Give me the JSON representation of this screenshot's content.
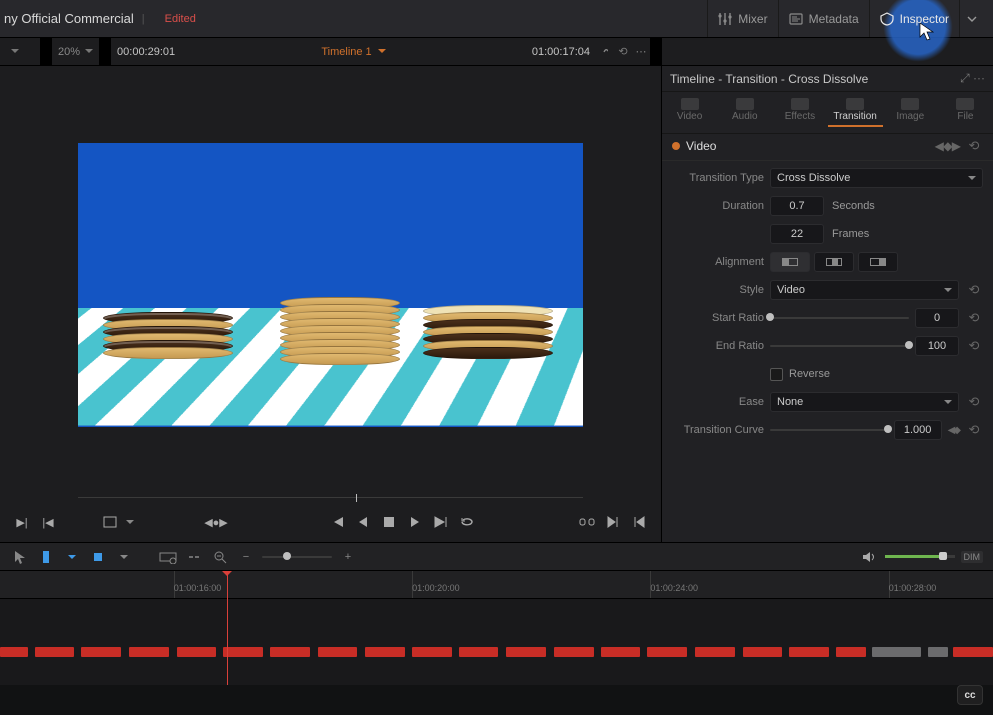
{
  "header": {
    "project_title": "ny Official Commercial",
    "project_state": "Edited",
    "buttons": {
      "mixer": "Mixer",
      "metadata": "Metadata",
      "inspector": "Inspector"
    }
  },
  "subbar": {
    "zoom": "20%",
    "left_tc": "00:00:29:01",
    "timeline_name": "Timeline 1",
    "main_tc": "01:00:17:04"
  },
  "inspector": {
    "crumb": "Timeline - Transition - Cross Dissolve",
    "tabs": {
      "video": "Video",
      "audio": "Audio",
      "effects": "Effects",
      "transition": "Transition",
      "image": "Image",
      "file": "File"
    },
    "section_title": "Video",
    "labels": {
      "transition_type": "Transition Type",
      "duration": "Duration",
      "alignment": "Alignment",
      "style": "Style",
      "start_ratio": "Start Ratio",
      "end_ratio": "End Ratio",
      "reverse": "Reverse",
      "ease": "Ease",
      "transition_curve": "Transition Curve"
    },
    "values": {
      "transition_type": "Cross Dissolve",
      "duration_sec": "0.7",
      "duration_sec_unit": "Seconds",
      "duration_frames": "22",
      "duration_frames_unit": "Frames",
      "style": "Video",
      "start_ratio": "0",
      "end_ratio": "100",
      "ease": "None",
      "transition_curve": "1.000"
    }
  },
  "timeline": {
    "ticks": [
      "01:00:16:00",
      "01:00:20:00",
      "01:00:24:00",
      "01:00:28:00"
    ]
  },
  "cc": "cc"
}
